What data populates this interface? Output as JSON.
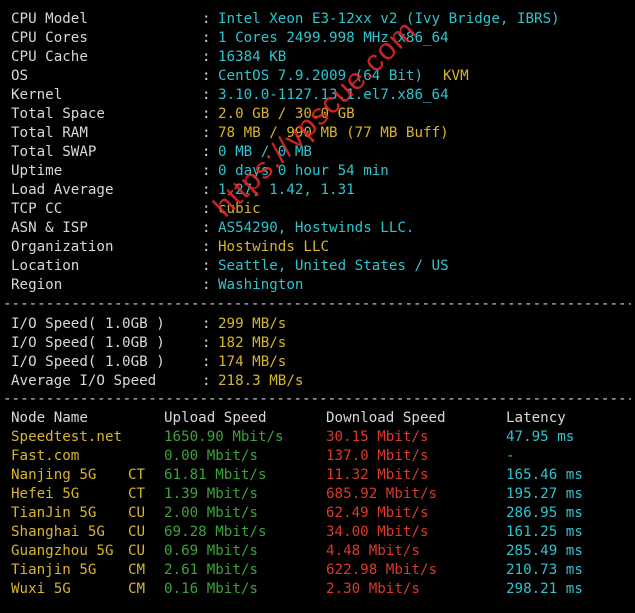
{
  "system_info": [
    {
      "label": "CPU Model",
      "value": "Intel Xeon E3-12xx v2 (Ivy Bridge, IBRS)",
      "color": "cyan"
    },
    {
      "label": "CPU Cores",
      "value": "1 Cores 2499.998 MHz x86_64",
      "color": "cyan"
    },
    {
      "label": "CPU Cache",
      "value": "16384 KB",
      "color": "cyan"
    },
    {
      "label": "OS",
      "value": "CentOS 7.9.2009 (64 Bit) ",
      "value_extra": "KVM",
      "color": "cyan"
    },
    {
      "label": "Kernel",
      "value": "3.10.0-1127.13.1.el7.x86_64",
      "color": "cyan"
    },
    {
      "label": "Total Space",
      "value": "2.0 GB / 30.0 GB",
      "color": "yellow"
    },
    {
      "label": "Total RAM",
      "value": "78 MB / 990 MB (77 MB Buff)",
      "color": "yellow"
    },
    {
      "label": "Total SWAP",
      "value": "0 MB / 0 MB",
      "color": "cyan"
    },
    {
      "label": "Uptime",
      "value": "0 days 0 hour 54 min",
      "color": "cyan"
    },
    {
      "label": "Load Average",
      "value": "1.27, 1.42, 1.31",
      "color": "cyan"
    },
    {
      "label": "TCP CC",
      "value": "cubic",
      "color": "yellow"
    },
    {
      "label": "ASN & ISP",
      "value": "AS54290, Hostwinds LLC.",
      "color": "cyan"
    },
    {
      "label": "Organization",
      "value": "Hostwinds LLC",
      "color": "yellow"
    },
    {
      "label": "Location",
      "value": "Seattle, United States / US",
      "color": "cyan"
    },
    {
      "label": "Region",
      "value": "Washington",
      "color": "cyan"
    }
  ],
  "separator": "-----------------------------------------------------------------------------------",
  "io_info": [
    {
      "label": "I/O Speed( 1.0GB )",
      "value": "299 MB/s"
    },
    {
      "label": "I/O Speed( 1.0GB )",
      "value": "182 MB/s"
    },
    {
      "label": "I/O Speed( 1.0GB )",
      "value": "174 MB/s"
    },
    {
      "label": "Average I/O Speed",
      "value": "218.3 MB/s"
    }
  ],
  "colon": ":",
  "speed_headers": {
    "node": "Node Name",
    "upload": "Upload Speed",
    "download": "Download Speed",
    "latency": "Latency"
  },
  "speed_rows": [
    {
      "node": "Speedtest.net",
      "isp": "",
      "upload": "1650.90 Mbit/s",
      "download": "30.15 Mbit/s",
      "latency": "47.95 ms"
    },
    {
      "node": "Fast.com",
      "isp": "",
      "upload": "0.00 Mbit/s",
      "download": "137.0 Mbit/s",
      "latency": "-"
    },
    {
      "node": "Nanjing 5G",
      "isp": "CT",
      "upload": "61.81 Mbit/s",
      "download": "11.32 Mbit/s",
      "latency": "165.46 ms"
    },
    {
      "node": "Hefei 5G",
      "isp": "CT",
      "upload": "1.39 Mbit/s",
      "download": "685.92 Mbit/s",
      "latency": "195.27 ms"
    },
    {
      "node": "TianJin 5G",
      "isp": "CU",
      "upload": "2.00 Mbit/s",
      "download": "62.49 Mbit/s",
      "latency": "286.95 ms"
    },
    {
      "node": "Shanghai 5G",
      "isp": "CU",
      "upload": "69.28 Mbit/s",
      "download": "34.00 Mbit/s",
      "latency": "161.25 ms"
    },
    {
      "node": "Guangzhou 5G",
      "isp": "CU",
      "upload": "0.69 Mbit/s",
      "download": "4.48 Mbit/s",
      "latency": "285.49 ms"
    },
    {
      "node": "Tianjin 5G",
      "isp": "CM",
      "upload": "2.61 Mbit/s",
      "download": "622.98 Mbit/s",
      "latency": "210.73 ms"
    },
    {
      "node": "Wuxi 5G",
      "isp": "CM",
      "upload": "0.16 Mbit/s",
      "download": "2.30 Mbit/s",
      "latency": "298.21 ms"
    }
  ],
  "watermark": "https://vpscue.com",
  "colors": {
    "background": "#000000",
    "label": "#d0d0d0",
    "cyan": "#2ec4cf",
    "yellow": "#d7b52c",
    "green": "#3aa33a",
    "red": "#d93a2a"
  }
}
